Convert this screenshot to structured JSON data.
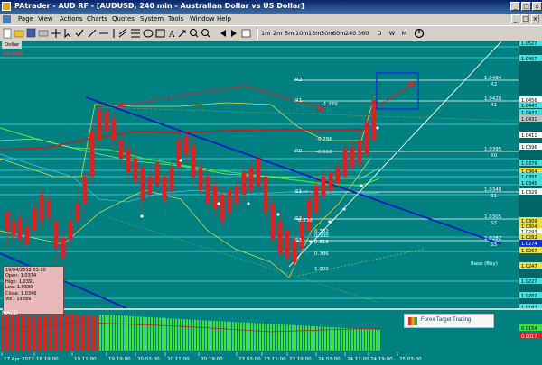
{
  "window": {
    "title": "PAtrader - AUD RF - [AUDUSD, 240 min - Australian Dollar vs US Dollar]",
    "minimize": "_",
    "maximize": "□",
    "close": "x"
  },
  "menu": {
    "items": [
      "Page",
      "View",
      "Actions",
      "Charts",
      "Quotes",
      "System",
      "Tools",
      "Window",
      "Help"
    ],
    "window_controls": [
      "_",
      "□",
      "x"
    ]
  },
  "toolbar": {
    "timeframes": [
      "1m",
      "2m",
      "5m",
      "10m",
      "15m",
      "30m",
      "60m",
      "240",
      "360",
      "D",
      "W",
      "M"
    ]
  },
  "chart": {
    "tab_label": "Dollar",
    "locked_label": "Locked",
    "background": "#008080",
    "bull_color": "#40e040",
    "bear_color": "#e02020",
    "ohlc": {
      "date": "19/04/2012 03:00",
      "open": "Open: 1.0374",
      "high": "High: 1.0391",
      "low": "Low: 1.0330",
      "close": "Close: 1.0346",
      "vol": "Vol.: 19399"
    },
    "price_labels": [
      "1.0527",
      "1.0467",
      "1.0456",
      "1.0447",
      "1.0437",
      "1.0431",
      "1.0411",
      "1.0396",
      "1.0379",
      "1.0364",
      "1.0355",
      "1.0345",
      "1.0329",
      "1.0309",
      "1.0304",
      "1.0293",
      "1.0282",
      "1.0274",
      "1.0267",
      "1.0247",
      "1.0227",
      "1.0207",
      "1.0187"
    ],
    "macd_labels": [
      "0.0154",
      "0.0017"
    ],
    "levels_right": [
      {
        "name": "R2",
        "value": "1.0484"
      },
      {
        "name": "R1",
        "value": "1.0420"
      },
      {
        "name": "R0",
        "value": "1.0395"
      },
      {
        "name": "S1",
        "value": "1.0340"
      },
      {
        "name": "S2",
        "value": "1.0305"
      },
      {
        "name": "S3",
        "value": "1.0282"
      }
    ],
    "levels_left": [
      "R2",
      "R1",
      "R0",
      "S1",
      "S2",
      "S3"
    ],
    "fib_labels": [
      "-1.270",
      "-0.786",
      "-0.618",
      "0.236",
      "0.382",
      "0.500",
      "0.618",
      "0.786",
      "1.000"
    ],
    "base_label": "Base (Buy)",
    "macd_label": "MACD",
    "time_labels": [
      "17 Apr 2012",
      "18 19:00",
      "19 11:00",
      "19 19:00",
      "20 03:00",
      "20 11:00",
      "20 19:00",
      "23 03:00",
      "23 11:00",
      "23 19:00",
      "24 03:00",
      "24 11:00",
      "24 19:00",
      "25 03:00"
    ],
    "logo_text": "Forex Target Trading"
  }
}
